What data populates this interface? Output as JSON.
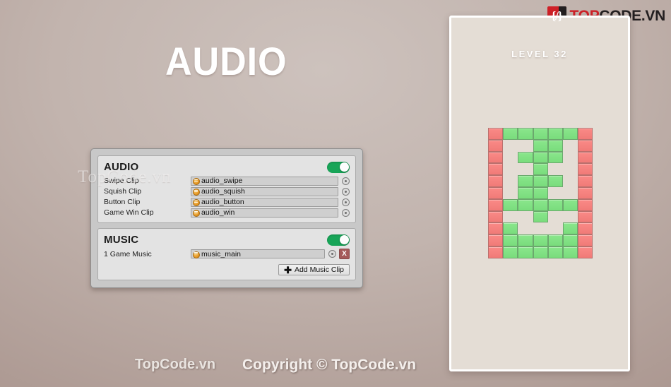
{
  "brand": {
    "logo_glyph": "{/}",
    "logo_text_red": "TOP",
    "logo_text_dark": "CODE.VN",
    "accent_red": "#cf2027",
    "accent_dark": "#231f20"
  },
  "page": {
    "title": "AUDIO"
  },
  "watermarks": {
    "panel_overlay": "TopCode.vn",
    "bottom_left": "TopCode.vn",
    "bottom_copyright": "Copyright © TopCode.vn"
  },
  "inspector": {
    "audio_panel": {
      "title": "AUDIO",
      "enabled": true,
      "toggle_color": "#18a558",
      "fields": [
        {
          "label": "Swipe Clip",
          "value": "audio_swipe",
          "icon": "audio-clip-icon",
          "picker": "object-picker-icon"
        },
        {
          "label": "Squish Clip",
          "value": "audio_squish",
          "icon": "audio-clip-icon",
          "picker": "object-picker-icon"
        },
        {
          "label": "Button Clip",
          "value": "audio_button",
          "icon": "audio-clip-icon",
          "picker": "object-picker-icon"
        },
        {
          "label": "Game Win Clip",
          "value": "audio_win",
          "icon": "audio-clip-icon",
          "picker": "object-picker-icon"
        }
      ]
    },
    "music_panel": {
      "title": "MUSIC",
      "enabled": true,
      "toggle_color": "#18a558",
      "rows": [
        {
          "index": "1",
          "label": "Game Music",
          "value": "music_main",
          "icon": "audio-clip-icon",
          "remove_label": "X"
        }
      ],
      "add_button": {
        "plus": "✚",
        "label": "Add Music Clip"
      }
    }
  },
  "game_preview": {
    "level_label": "LEVEL 32",
    "colors": {
      "red": "#f8817e",
      "green": "#82e184",
      "board_bg": "#e4ddd5"
    },
    "grid": {
      "cols": 7,
      "rows": 11,
      "legend": {
        "R": "red-block",
        "G": "green-block",
        "_": "empty-cell"
      },
      "cells": [
        [
          "R",
          "G",
          "G",
          "G",
          "G",
          "G",
          "R"
        ],
        [
          "R",
          "_",
          "_",
          "G",
          "G",
          "_",
          "R"
        ],
        [
          "R",
          "_",
          "G",
          "G",
          "G",
          "_",
          "R"
        ],
        [
          "R",
          "_",
          "_",
          "G",
          "_",
          "_",
          "R"
        ],
        [
          "R",
          "_",
          "G",
          "G",
          "G",
          "_",
          "R"
        ],
        [
          "R",
          "_",
          "G",
          "G",
          "_",
          "_",
          "R"
        ],
        [
          "R",
          "G",
          "G",
          "G",
          "G",
          "G",
          "R"
        ],
        [
          "R",
          "_",
          "_",
          "G",
          "_",
          "_",
          "R"
        ],
        [
          "R",
          "G",
          "_",
          "_",
          "_",
          "G",
          "R"
        ],
        [
          "R",
          "G",
          "G",
          "G",
          "G",
          "G",
          "R"
        ],
        [
          "R",
          "G",
          "G",
          "G",
          "G",
          "G",
          "R"
        ]
      ]
    }
  }
}
